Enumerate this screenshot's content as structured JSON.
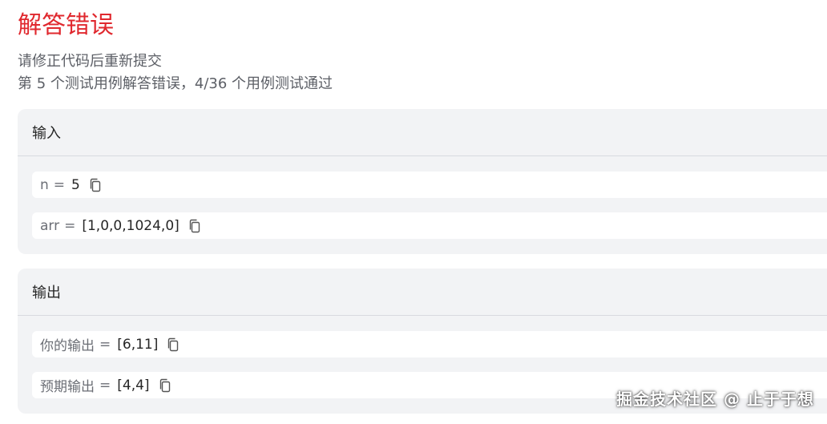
{
  "result": {
    "title": "解答错误",
    "subtitle": "请修正代码后重新提交",
    "summary": "第 5 个测试用例解答错误，4/36 个用例测试通过"
  },
  "input_panel": {
    "header": "输入",
    "rows": [
      {
        "label": "n",
        "equals": "=",
        "value": "5"
      },
      {
        "label": "arr",
        "equals": "=",
        "value": "[1,0,0,1024,0]"
      }
    ]
  },
  "output_panel": {
    "header": "输出",
    "rows": [
      {
        "label": "你的输出",
        "equals": "=",
        "value": "[6,11]"
      },
      {
        "label": "预期输出",
        "equals": "=",
        "value": "[4,4]"
      }
    ]
  },
  "watermark": "掘金技术社区 @ 止于于想",
  "colors": {
    "error_red": "#e0282e",
    "panel_bg": "#f2f3f5",
    "row_bg": "#ffffff"
  },
  "icons": {
    "copy": "copy-icon"
  }
}
